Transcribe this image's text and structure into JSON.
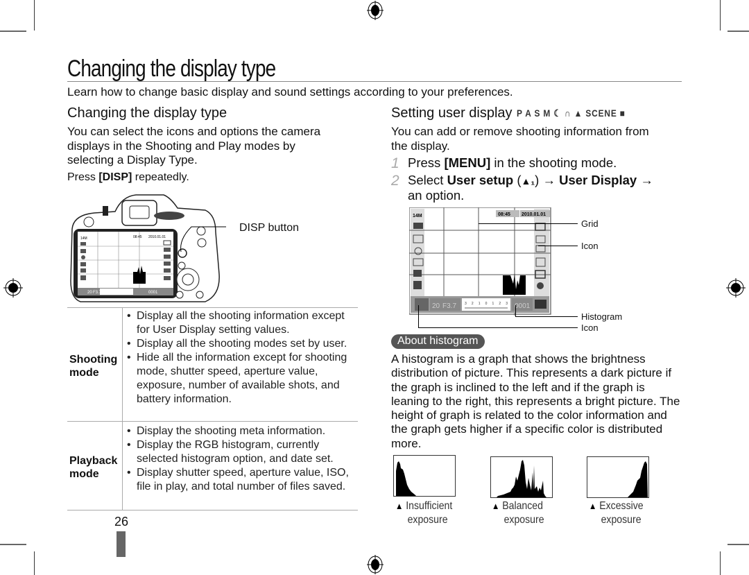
{
  "page": {
    "title": "Changing the display type",
    "intro": "Learn how to change basic display and sound settings according to your preferences.",
    "page_number": "26"
  },
  "left": {
    "heading": "Changing the display type",
    "description": "You can select the icons and options the camera displays in the Shooting and Play modes by selecting a Display Type.",
    "press_prefix": "Press ",
    "press_key": "[DISP]",
    "press_suffix": " repeatedly.",
    "callout_disp": "DISP button",
    "camera_lcd": {
      "time": "08:45",
      "date": "2010.01.01",
      "resolution": "14M",
      "shots": "20",
      "aperture": "F3.7",
      "counter": "0001"
    },
    "table": [
      {
        "mode": "Shooting mode",
        "mode_line1": "Shooting",
        "mode_line2": "mode",
        "items": [
          "Display all the shooting information except for User Display setting values.",
          "Display all the shooting modes set by user.",
          "Hide all the information except for shooting mode, shutter speed, aperture value, exposure, number of available shots, and battery information."
        ]
      },
      {
        "mode": "Playback mode",
        "mode_line1": "Playback",
        "mode_line2": "mode",
        "items": [
          "Display the shooting meta information.",
          "Display the RGB histogram, currently selected histogram option, and date set.",
          "Display shutter speed, aperture value, ISO, file in play, and total number of files saved."
        ]
      }
    ]
  },
  "right": {
    "heading": "Setting user display",
    "mode_icons": "P A S M ☾ ∩ ▲ SCENE ■",
    "description": "You can add or remove shooting information from the display.",
    "steps": [
      {
        "num": "1",
        "pre": "Press ",
        "bold": "[MENU]",
        "post": " in the shooting mode."
      },
      {
        "num": "2",
        "pre": "Select ",
        "bold": "User setup",
        "mid": " (",
        "icon": "▲₁",
        "mid2": ") → ",
        "bold2": "User Display",
        "post": " →",
        "line2": "an option."
      }
    ],
    "lcd": {
      "resolution": "14M",
      "time": "08:45",
      "date": "2010.01.01",
      "shots": "20",
      "aperture": "F3.7",
      "counter": "0001",
      "scale": "3 2 1 0 1 2 3"
    },
    "callouts": {
      "grid": "Grid",
      "icon1": "Icon",
      "histogram": "Histogram",
      "icon2": "Icon"
    },
    "about_label": "About histogram",
    "about_text": "A histogram is a graph that shows the brightness distribution of picture. This represents a dark picture if the graph is inclined to the left and if the graph is leaning to the right, this represents a bright picture. The height of graph is related to the color information and the graph gets higher if a specific color is distributed more.",
    "histograms": [
      {
        "marker": "▲",
        "line1": "Insufficient",
        "line2": "exposure"
      },
      {
        "marker": "▲",
        "line1": "Balanced",
        "line2": "exposure"
      },
      {
        "marker": "▲",
        "line1": "Excessive",
        "line2": "exposure"
      }
    ]
  }
}
